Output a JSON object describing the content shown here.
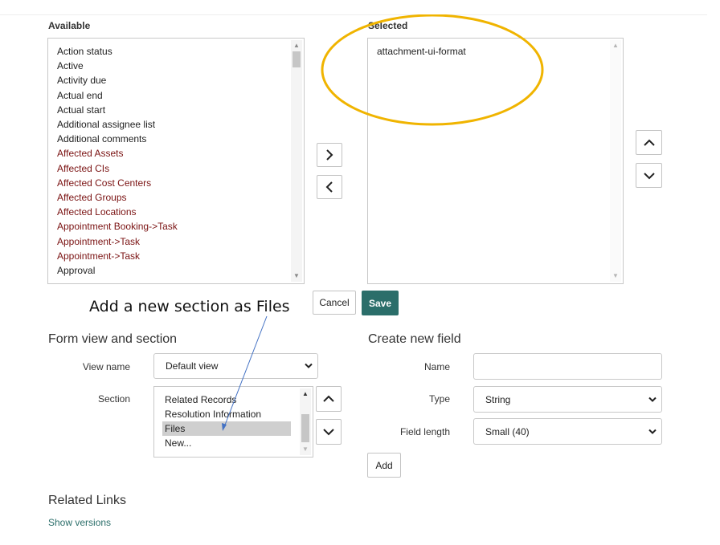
{
  "available": {
    "label": "Available",
    "items": [
      {
        "text": "Action status",
        "ref": false
      },
      {
        "text": "Active",
        "ref": false
      },
      {
        "text": "Activity due",
        "ref": false
      },
      {
        "text": "Actual end",
        "ref": false
      },
      {
        "text": "Actual start",
        "ref": false
      },
      {
        "text": "Additional assignee list",
        "ref": false
      },
      {
        "text": "Additional comments",
        "ref": false
      },
      {
        "text": "Affected Assets",
        "ref": true
      },
      {
        "text": "Affected CIs",
        "ref": true
      },
      {
        "text": "Affected Cost Centers",
        "ref": true
      },
      {
        "text": "Affected Groups",
        "ref": true
      },
      {
        "text": "Affected Locations",
        "ref": true
      },
      {
        "text": "Appointment Booking->Task",
        "ref": true
      },
      {
        "text": "Appointment->Task",
        "ref": true
      },
      {
        "text": "Appointment->Task",
        "ref": true
      },
      {
        "text": "Approval",
        "ref": false
      }
    ],
    "scroll_fraction": 0.0
  },
  "selected": {
    "label": "Selected",
    "items": [
      "attachment-ui-format"
    ]
  },
  "move_buttons": {
    "add": "chevron-right-icon",
    "remove": "chevron-left-icon"
  },
  "order_buttons": {
    "up": "chevron-up-icon",
    "down": "chevron-down-icon"
  },
  "actions": {
    "cancel_label": "Cancel",
    "save_label": "Save"
  },
  "annotation": {
    "text": "Add a new section as Files",
    "ellipse_color": "#f0b400",
    "arrow_color": "#4472c4"
  },
  "form_view": {
    "heading": "Form view and section",
    "view_name_label": "View name",
    "view_name_value": "Default view",
    "section_label": "Section",
    "section_items": [
      "Related Records",
      "Resolution Information",
      "Files",
      "New..."
    ],
    "section_selected": "Files"
  },
  "new_field": {
    "heading": "Create new field",
    "name_label": "Name",
    "name_value": "",
    "type_label": "Type",
    "type_value": "String",
    "length_label": "Field length",
    "length_value": "Small (40)",
    "add_label": "Add"
  },
  "related_links": {
    "heading": "Related Links",
    "show_versions": "Show versions"
  },
  "colors": {
    "save": "#2b6e6a",
    "reference_field": "#7a1212",
    "link": "#2b6e6a",
    "section_highlight": "#cfcfcf"
  }
}
